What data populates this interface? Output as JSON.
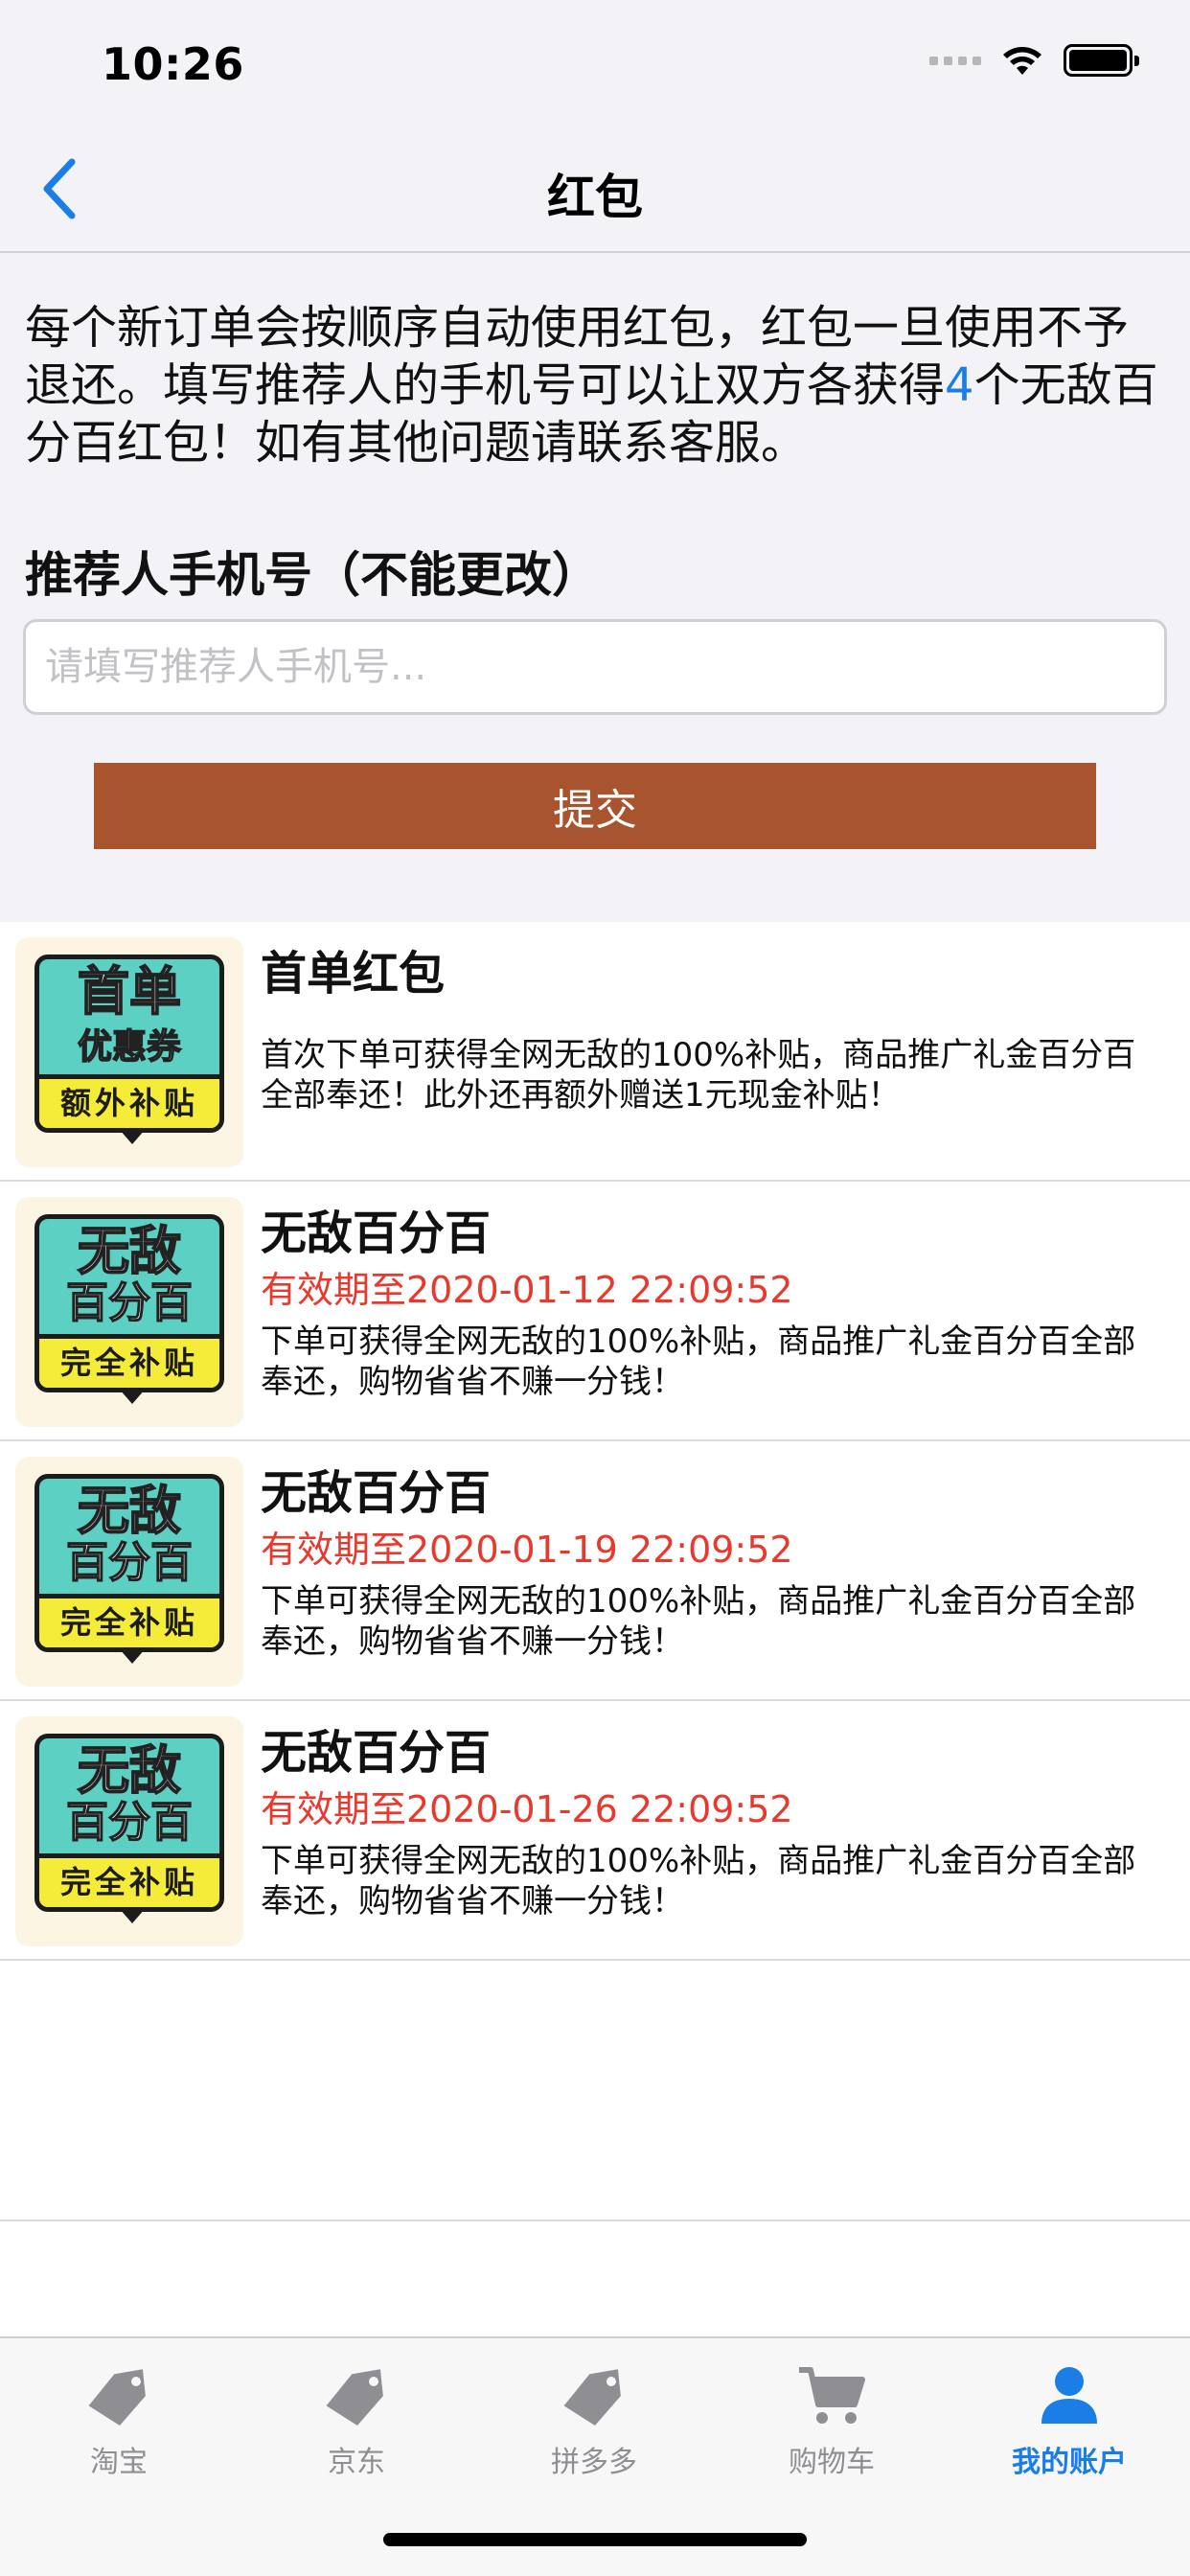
{
  "status": {
    "time": "10:26"
  },
  "nav": {
    "title": "红包"
  },
  "intro": {
    "text_before": "每个新订单会按顺序自动使用红包，红包一旦使用不予退还。填写推荐人的手机号可以让双方各获得",
    "highlight": "4",
    "text_after": "个无敌百分百红包！如有其他问题请联系客服。"
  },
  "referrer": {
    "label": "推荐人手机号（不能更改）",
    "placeholder": "请填写推荐人手机号...",
    "value": "",
    "submit_label": "提交"
  },
  "coupons": [
    {
      "icon": {
        "line1": "首单",
        "line2": "优惠券",
        "band": "额外补贴"
      },
      "title": "首单红包",
      "expire": "",
      "description": "首次下单可获得全网无敌的100%补贴，商品推广礼金百分百全部奉还！此外还再额外赠送1元现金补贴！"
    },
    {
      "icon": {
        "line1": "无敌",
        "line2": "百分百",
        "band": "完全补贴"
      },
      "title": "无敌百分百",
      "expire": "有效期至2020-01-12 22:09:52",
      "description": "下单可获得全网无敌的100%补贴，商品推广礼金百分百全部奉还，购物省省不赚一分钱！"
    },
    {
      "icon": {
        "line1": "无敌",
        "line2": "百分百",
        "band": "完全补贴"
      },
      "title": "无敌百分百",
      "expire": "有效期至2020-01-19 22:09:52",
      "description": "下单可获得全网无敌的100%补贴，商品推广礼金百分百全部奉还，购物省省不赚一分钱！"
    },
    {
      "icon": {
        "line1": "无敌",
        "line2": "百分百",
        "band": "完全补贴"
      },
      "title": "无敌百分百",
      "expire": "有效期至2020-01-26 22:09:52",
      "description": "下单可获得全网无敌的100%补贴，商品推广礼金百分百全部奉还，购物省省不赚一分钱！"
    }
  ],
  "tabs": [
    {
      "label": "淘宝",
      "icon": "tag-icon",
      "active": false
    },
    {
      "label": "京东",
      "icon": "tag-icon",
      "active": false
    },
    {
      "label": "拼多多",
      "icon": "tag-icon",
      "active": false
    },
    {
      "label": "购物车",
      "icon": "cart-icon",
      "active": false
    },
    {
      "label": "我的账户",
      "icon": "person-icon",
      "active": true
    }
  ],
  "colors": {
    "accent": "#1a7ee6",
    "submit": "#a8542f",
    "expire": "#e8392c",
    "inactive_tab": "#8e8e93"
  }
}
